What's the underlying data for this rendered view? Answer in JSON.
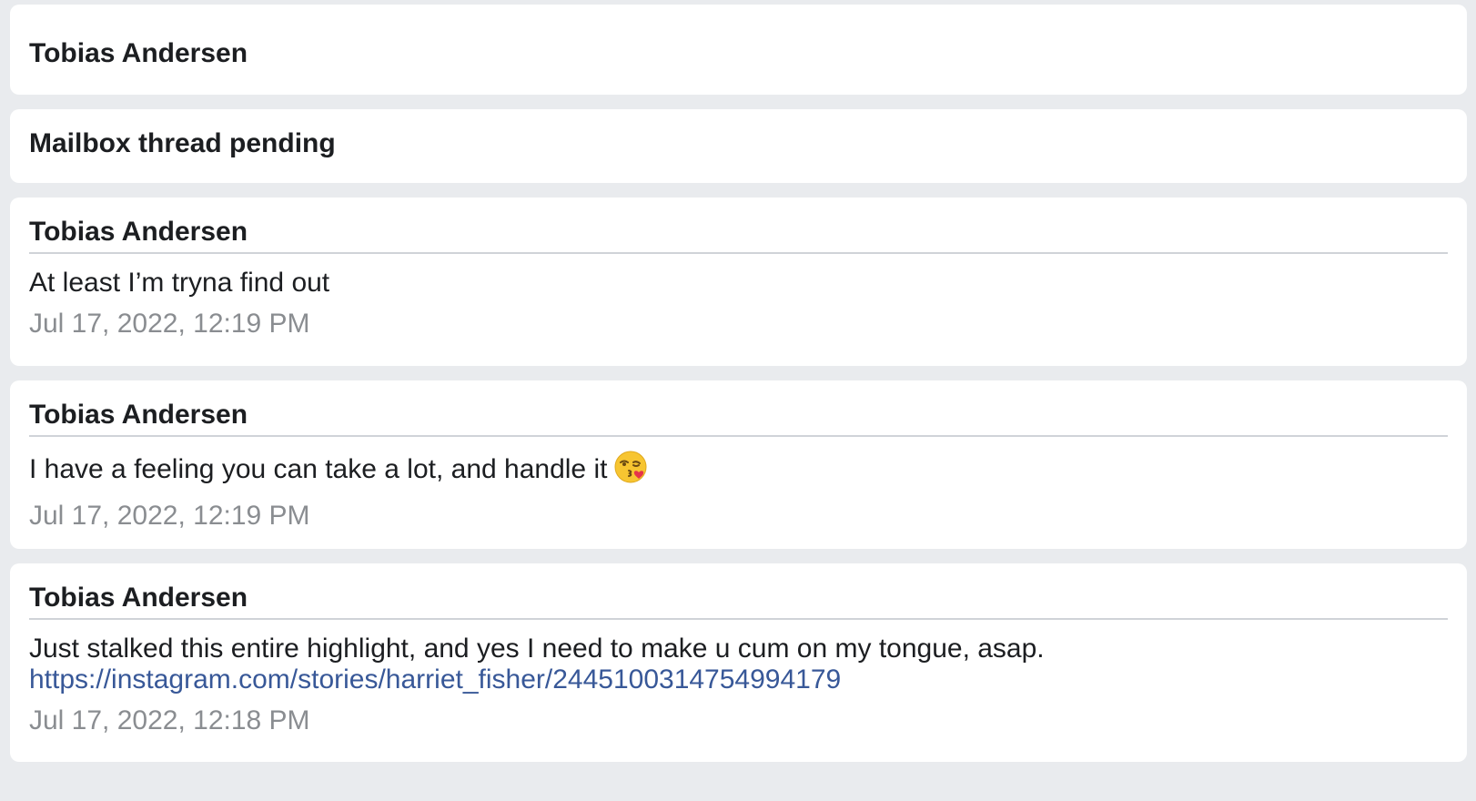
{
  "thread": {
    "cards": [
      {
        "type": "header_only",
        "sender": "Tobias Andersen"
      },
      {
        "type": "status",
        "text": "Mailbox thread pending"
      },
      {
        "type": "message",
        "sender": "Tobias Andersen",
        "body": "At least I’m tryna find out",
        "timestamp": "Jul 17, 2022, 12:19 PM"
      },
      {
        "type": "message",
        "sender": "Tobias Andersen",
        "body": "I have a feeling you can take a lot, and handle it",
        "emoji": "kissing-face-with-heart-icon",
        "timestamp": "Jul 17, 2022, 12:19 PM"
      },
      {
        "type": "message",
        "sender": "Tobias Andersen",
        "body": "Just stalked this entire highlight, and yes I need to make u cum on my tongue, asap.",
        "link": "https://instagram.com/stories/harriet_fisher/2445100314754994179",
        "timestamp": "Jul 17, 2022, 12:18 PM"
      }
    ]
  },
  "colors": {
    "page_background": "#e9ebee",
    "card_background": "#ffffff",
    "text_primary": "#1c1e21",
    "text_secondary": "#8a8d91",
    "link": "#385898",
    "divider": "#d0d3d8"
  }
}
